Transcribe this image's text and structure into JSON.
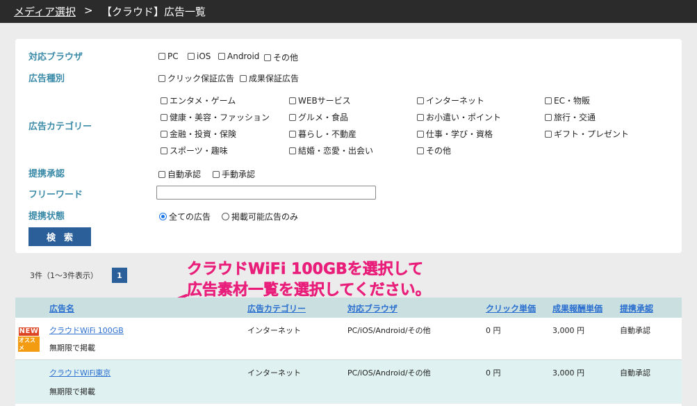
{
  "breadcrumb": {
    "link": "メディア選択",
    "separator": ">",
    "current": "【クラウド】広告一覧"
  },
  "filters": {
    "browser": {
      "label": "対応ブラウザ",
      "options": [
        "PC",
        "iOS",
        "Android",
        "その他"
      ]
    },
    "ad_type": {
      "label": "広告種別",
      "options": [
        "クリック保証広告",
        "成果保証広告"
      ]
    },
    "category": {
      "label": "広告カテゴリー",
      "options": [
        "エンタメ・ゲーム",
        "WEBサービス",
        "インターネット",
        "EC・物販",
        "健康・美容・ファッション",
        "グルメ・食品",
        "お小遣い・ポイント",
        "旅行・交通",
        "金融・投資・保険",
        "暮らし・不動産",
        "仕事・学び・資格",
        "ギフト・プレゼント",
        "スポーツ・趣味",
        "結婚・恋愛・出会い",
        "その他"
      ]
    },
    "approval": {
      "label": "提携承認",
      "options": [
        "自動承認",
        "手動承認"
      ]
    },
    "freeword": {
      "label": "フリーワード",
      "value": ""
    },
    "status": {
      "label": "提携状態",
      "options": [
        "全ての広告",
        "掲載可能広告のみ"
      ],
      "selected": "全ての広告"
    },
    "search_label": "検索"
  },
  "results": {
    "count_text": "3件（1～3件表示）",
    "page": "1"
  },
  "annotation": {
    "line1": "クラウドWiFi 100GBを選択して",
    "line2": "広告素材一覧を選択してください。"
  },
  "table": {
    "headers": [
      "広告名",
      "広告カテゴリー",
      "対応ブラウザ",
      "クリック単価",
      "成果報酬単価",
      "提携承認"
    ],
    "rows": [
      {
        "badge_new": "NEW",
        "badge_sub": "オススメ",
        "name": "クラウドWiFi 100GB",
        "note": "無期限で掲載",
        "category": "インターネット",
        "browser": "PC/iOS/Android/その他",
        "click_price": "0 円",
        "reward_price": "3,000 円",
        "approval": "自動承認"
      },
      {
        "name": "クラウドWiFi東京",
        "note": "無期限で掲載",
        "category": "インターネット",
        "browser": "PC/iOS/Android/その他",
        "click_price": "0 円",
        "reward_price": "3,000 円",
        "approval": "自動承認"
      }
    ]
  },
  "colors": {
    "label": "#3a8aa8",
    "link": "#2a6ecf",
    "button": "#2a5f9a",
    "annotation": "#e91e7a",
    "header_bg": "#c9dfe0"
  }
}
